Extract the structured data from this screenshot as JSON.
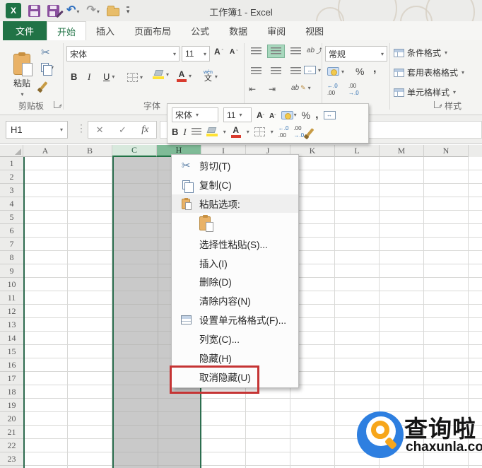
{
  "title_bar": {
    "title": "工作簿1 - Excel"
  },
  "tabs": [
    {
      "key": "file",
      "label": "文件",
      "file": true
    },
    {
      "key": "home",
      "label": "开始",
      "active": true
    },
    {
      "key": "insert",
      "label": "插入"
    },
    {
      "key": "page-layout",
      "label": "页面布局"
    },
    {
      "key": "formulas",
      "label": "公式"
    },
    {
      "key": "data",
      "label": "数据"
    },
    {
      "key": "review",
      "label": "审阅"
    },
    {
      "key": "view",
      "label": "视图"
    }
  ],
  "ribbon": {
    "paste_label": "粘贴",
    "clipboard_group": "剪贴板",
    "font_group": "字体",
    "styles_group": "样式",
    "font_name": "宋体",
    "font_size": "11",
    "number_format": "常规",
    "styles_buttons": [
      "条件格式",
      "套用表格格式",
      "单元格样式"
    ]
  },
  "mini_toolbar": {
    "font_name": "宋体",
    "font_size": "11"
  },
  "glyphs": {
    "bold": "B",
    "italic": "I",
    "underline": "U",
    "grow_font": "A",
    "shrink_font": "A",
    "percent": "%",
    "comma": ",",
    "cancel": "✕",
    "confirm": "✓",
    "fx": "fx",
    "phonetic_top": "wén",
    "phonetic_char": "文",
    "inc_dec_top": "←.0",
    "inc_dec_bottom": ".00",
    "dec_dec_top": ".00",
    "dec_dec_bottom": "→.0",
    "orientation": "ab",
    "wrap": "ab",
    "merge_arrows": "↔",
    "align_caret": "▾",
    "dots": "⋮"
  },
  "formula_bar": {
    "name_box": "H1"
  },
  "grid": {
    "columns": [
      {
        "label": "A",
        "state": "normal"
      },
      {
        "label": "B",
        "state": "normal"
      },
      {
        "label": "C",
        "state": "selected"
      },
      {
        "label": "H",
        "state": "selected-active"
      },
      {
        "label": "I",
        "state": "normal"
      },
      {
        "label": "J",
        "state": "normal"
      },
      {
        "label": "K",
        "state": "normal"
      },
      {
        "label": "L",
        "state": "normal"
      },
      {
        "label": "M",
        "state": "normal"
      },
      {
        "label": "N",
        "state": "normal"
      }
    ],
    "rows": [
      "1",
      "2",
      "3",
      "4",
      "5",
      "6",
      "7",
      "8",
      "9",
      "10",
      "11",
      "12",
      "13",
      "14",
      "15",
      "16",
      "17",
      "18",
      "19",
      "20",
      "21",
      "22",
      "23"
    ],
    "selected_columns": "C:H (columns D-G hidden)"
  },
  "context_menu": {
    "items": [
      {
        "key": "cut",
        "label": "剪切(T)",
        "icon": "scissors"
      },
      {
        "key": "copy",
        "label": "复制(C)",
        "icon": "copy"
      },
      {
        "key": "paste-options",
        "label": "粘贴选项:",
        "icon": "paste",
        "shaded": true
      },
      {
        "key": "paste-button",
        "label": "",
        "icon": "paste-large",
        "button": true
      },
      {
        "key": "paste-special",
        "label": "选择性粘贴(S)...",
        "icon": ""
      },
      {
        "key": "insert",
        "label": "插入(I)",
        "icon": ""
      },
      {
        "key": "delete",
        "label": "删除(D)",
        "icon": ""
      },
      {
        "key": "clear-contents",
        "label": "清除内容(N)",
        "icon": ""
      },
      {
        "key": "format-cells",
        "label": "设置单元格格式(F)...",
        "icon": "format-cells"
      },
      {
        "key": "column-width",
        "label": "列宽(C)...",
        "icon": ""
      },
      {
        "key": "hide",
        "label": "隐藏(H)",
        "icon": ""
      },
      {
        "key": "unhide",
        "label": "取消隐藏(U)",
        "icon": "",
        "annotated": true
      }
    ]
  },
  "watermark": {
    "brand": "查询啦",
    "domain": "chaxunla.com"
  },
  "colors": {
    "excel_green": "#217346",
    "selection_gray": "#c9c9c9",
    "selected_header_light": "#d8e9dd",
    "selected_header_dark": "#7fbb97",
    "annotation_red": "#c53434",
    "logo_blue": "#2e7fe0",
    "logo_orange": "#f7a61b"
  }
}
